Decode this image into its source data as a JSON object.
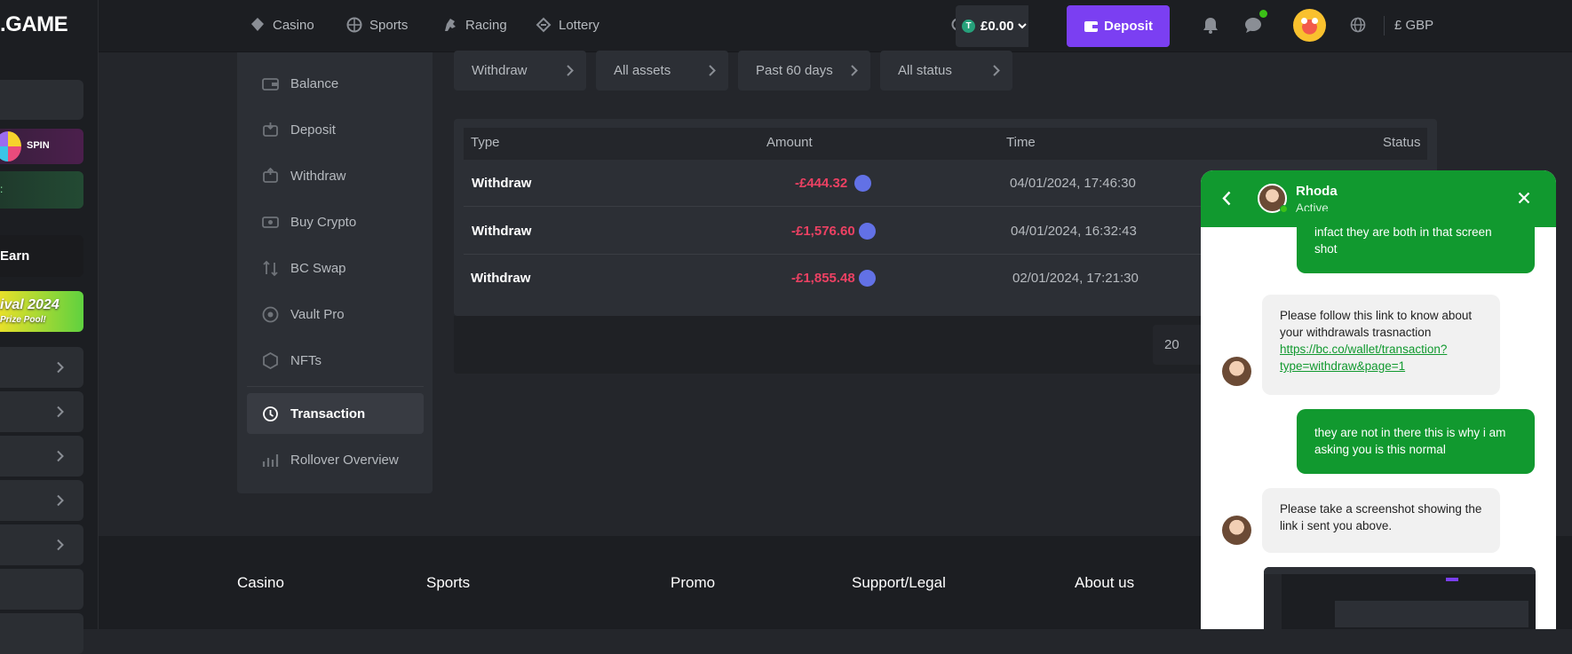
{
  "brand": {
    "logo": ".GAME"
  },
  "left_sidebar": {
    "spin_label": "SPIN",
    "earn_label": "Earn",
    "promo_banner_line1": "ival 2024",
    "promo_banner_line2": "Prize Pool!",
    "collapsed_item_count": 5
  },
  "header": {
    "nav": [
      {
        "label": "Casino",
        "icon": "casino-icon"
      },
      {
        "label": "Sports",
        "icon": "sports-icon"
      },
      {
        "label": "Racing",
        "icon": "racing-icon"
      },
      {
        "label": "Lottery",
        "icon": "lottery-icon"
      }
    ],
    "balance": "£0.00",
    "deposit_label": "Deposit",
    "currency": "£ GBP"
  },
  "account_menu": {
    "items": [
      {
        "label": "Balance",
        "icon": "wallet-icon"
      },
      {
        "label": "Deposit",
        "icon": "deposit-icon"
      },
      {
        "label": "Withdraw",
        "icon": "withdraw-icon"
      },
      {
        "label": "Buy Crypto",
        "icon": "buy-crypto-icon"
      },
      {
        "label": "BC Swap",
        "icon": "swap-icon"
      },
      {
        "label": "Vault Pro",
        "icon": "vault-icon"
      },
      {
        "label": "NFTs",
        "icon": "nft-icon"
      },
      {
        "label": "Transaction",
        "icon": "transaction-icon",
        "active": true
      },
      {
        "label": "Rollover Overview",
        "icon": "rollover-icon"
      }
    ]
  },
  "filters": [
    "Withdraw",
    "All assets",
    "Past 60 days",
    "All status"
  ],
  "table": {
    "columns": [
      "Type",
      "Amount",
      "Time",
      "Status"
    ],
    "rows": [
      {
        "type": "Withdraw",
        "amount": "-£444.32",
        "time": "04/01/2024, 17:46:30"
      },
      {
        "type": "Withdraw",
        "amount": "-£1,576.60",
        "time": "04/01/2024, 16:32:43"
      },
      {
        "type": "Withdraw",
        "amount": "-£1,855.48",
        "time": "02/01/2024, 17:21:30"
      }
    ],
    "page_size": "20"
  },
  "footer": {
    "columns": [
      "Casino",
      "Sports",
      "Promo",
      "Support/Legal",
      "About us"
    ]
  },
  "chat": {
    "agent_name": "Rhoda",
    "agent_status": "Active",
    "messages": [
      {
        "from": "me",
        "text": "infact they are both in that screen shot"
      },
      {
        "from": "them",
        "text": "Please follow this link to know about your withdrawals trasnaction ",
        "link": "https://bc.co/wallet/transaction?type=withdraw&page=1"
      },
      {
        "from": "me",
        "text": "they are not in there this is why i am asking you is this normal"
      },
      {
        "from": "them",
        "text": "Please take a screenshot showing the link i sent you above."
      }
    ]
  },
  "colors": {
    "accent_purple": "#7b3ff2",
    "chat_green": "#11992f",
    "negative_red": "#ed4163",
    "eth_blue": "#6271e6"
  }
}
